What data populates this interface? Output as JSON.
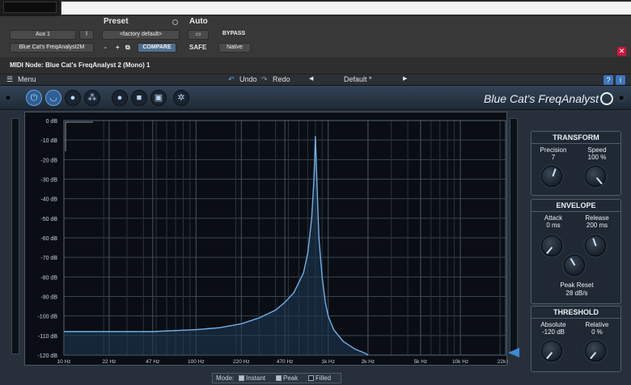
{
  "host": {
    "preset_label": "Preset",
    "auto_label": "Auto",
    "insert_label": "Aux 1",
    "insert_btn": "ǀ",
    "plugin_name": "Blue Cat's FreqAnalyst2M",
    "preset_value": "<factory default>",
    "minus": "-",
    "plus": "+",
    "compare": "COMPARE",
    "bypass": "BYPASS",
    "safe": "SAFE",
    "native": "Native",
    "midi_node": "MIDI Node: Blue Cat's FreqAnalyst 2 (Mono) 1"
  },
  "menubar": {
    "menu": "Menu",
    "undo": "Undo",
    "redo": "Redo",
    "preset_name": "Default *",
    "help": "?",
    "info": "i"
  },
  "plugin": {
    "brand": "Blue Cat's FreqAnalyst"
  },
  "chart_data": {
    "type": "line",
    "title": "",
    "xlabel": "",
    "ylabel": "",
    "x_scale": "log",
    "x_ticks": [
      "10 Hz",
      "22 Hz",
      "47 Hz",
      "100 Hz",
      "220 Hz",
      "470 Hz",
      "1k Hz",
      "2k Hz",
      "5k Hz",
      "10k Hz",
      "22k Hz"
    ],
    "x_tick_values": [
      10,
      22,
      47,
      100,
      220,
      470,
      1000,
      2000,
      5000,
      10000,
      22000
    ],
    "y_ticks": [
      "0 dB",
      "-10 dB",
      "-20 dB",
      "-30 dB",
      "-40 dB",
      "-50 dB",
      "-60 dB",
      "-70 dB",
      "-80 dB",
      "-90 dB",
      "-100 dB",
      "-110 dB",
      "-120 dB"
    ],
    "ylim": [
      -120,
      0
    ],
    "xlim": [
      10,
      22000
    ],
    "grid": true,
    "color": "#6fb0ea",
    "fill_color": "#1f3a56",
    "series": [
      {
        "x": [
          10,
          22,
          47,
          100,
          150,
          220,
          300,
          400,
          470,
          550,
          650,
          700,
          750,
          780,
          800,
          820,
          850,
          900,
          950,
          1000,
          1100,
          1300,
          1600,
          1900,
          2000
        ],
        "y": [
          -108,
          -108,
          -108,
          -107,
          -106,
          -104,
          -101,
          -97,
          -93,
          -88,
          -78,
          -68,
          -50,
          -30,
          -8,
          -30,
          -60,
          -80,
          -93,
          -100,
          -107,
          -113,
          -117,
          -119,
          -120
        ]
      }
    ]
  },
  "transform": {
    "title": "TRANSFORM",
    "precision_label": "Precision",
    "precision_value": "7",
    "speed_label": "Speed",
    "speed_value": "100 %"
  },
  "envelope": {
    "title": "ENVELOPE",
    "attack_label": "Attack",
    "attack_value": "0 ms",
    "release_label": "Release",
    "release_value": "200 ms",
    "peak_reset_label": "Peak Reset",
    "peak_reset_value": "28 dB/s"
  },
  "threshold": {
    "title": "THRESHOLD",
    "absolute_label": "Absolute",
    "absolute_value": "-120 dB",
    "relative_label": "Relative",
    "relative_value": "0 %"
  },
  "mode": {
    "label": "Mode:",
    "instant": "Instant",
    "peak": "Peak",
    "filled": "Filled"
  }
}
